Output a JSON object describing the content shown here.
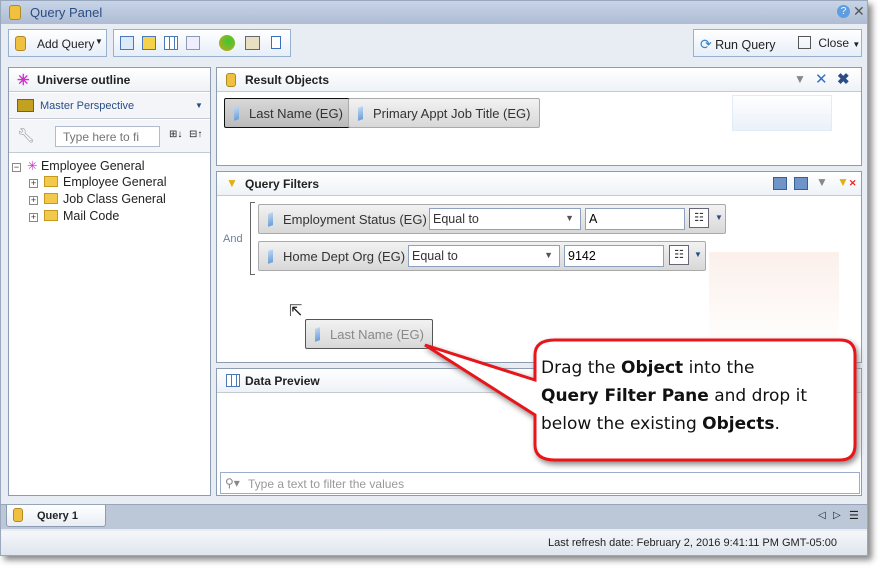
{
  "window": {
    "title": "Query Panel"
  },
  "toolbar": {
    "add_query": "Add Query",
    "run_query": "Run Query",
    "close": "Close"
  },
  "universe": {
    "title": "Universe outline",
    "perspective": "Master Perspective",
    "search_placeholder": "Type here to fi",
    "tree": {
      "root": "Employee General",
      "items": [
        "Employee General",
        "Job Class General",
        "Mail Code"
      ]
    }
  },
  "result_objects": {
    "title": "Result Objects",
    "objects": [
      "Last Name (EG)",
      "Primary Appt Job Title (EG)"
    ]
  },
  "query_filters": {
    "title": "Query Filters",
    "operator": "And",
    "filters": [
      {
        "object": "Employment Status (EG)",
        "op": "Equal to",
        "value": "A"
      },
      {
        "object": "Home Dept Org (EG)",
        "op": "Equal to",
        "value": "9142"
      }
    ],
    "dragged": "Last Name (EG)"
  },
  "data_preview": {
    "title": "Data Preview",
    "filter_placeholder": "Type a text to filter the values"
  },
  "tabs": [
    {
      "label": "Query 1"
    }
  ],
  "status": {
    "refresh": "Last refresh date: February 2, 2016 9:41:11 PM GMT-05:00"
  },
  "callout": {
    "p1": "Drag the ",
    "b1": "Object",
    "p2": " into the",
    "b2": "Query Filter Pane",
    "p3": " and drop it",
    "p4": "below the existing ",
    "b3": "Objects",
    "p5": ".",
    "color": "#e8161b"
  }
}
